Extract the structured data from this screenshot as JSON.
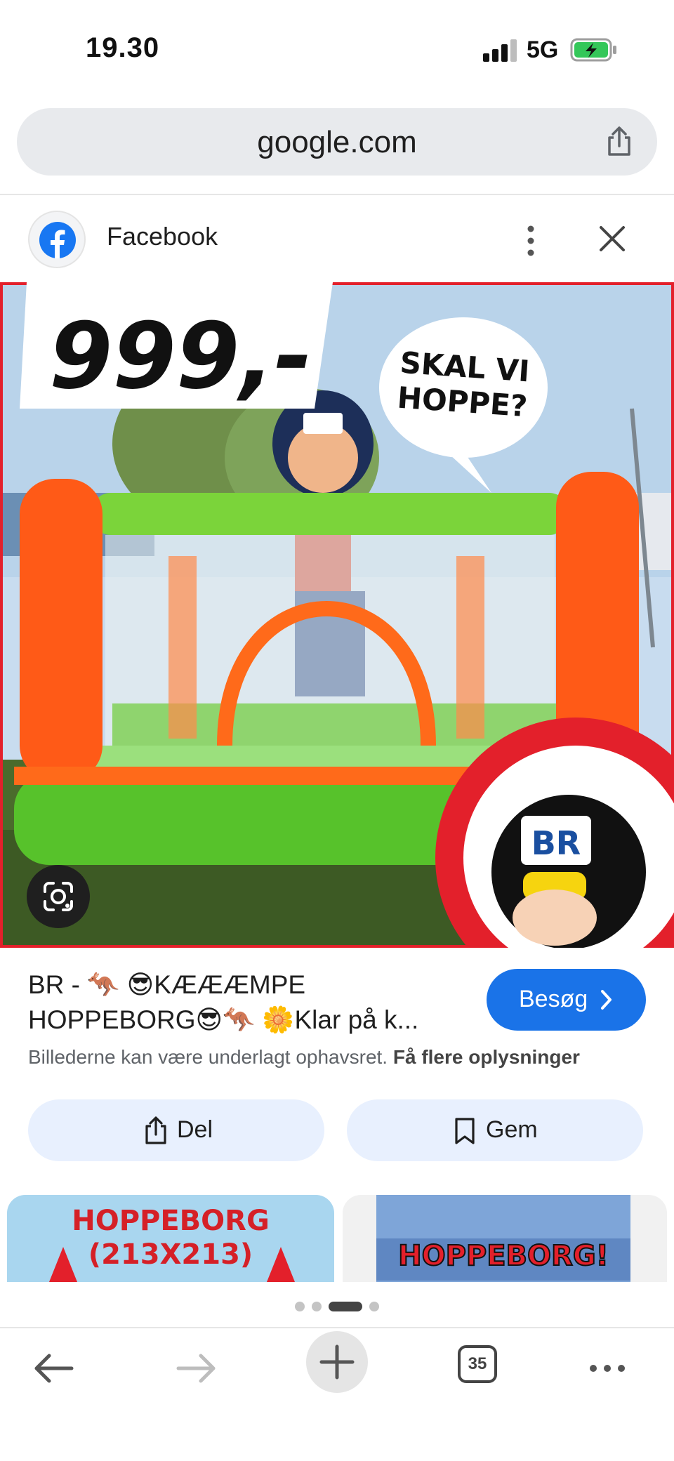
{
  "status_bar": {
    "time": "19.30",
    "network": "5G"
  },
  "url_bar": {
    "url": "google.com"
  },
  "source": {
    "name": "Facebook"
  },
  "image": {
    "price_tag": "999,-",
    "speech_bubble": "SKAL VI HOPPE?",
    "badge_text": "BR"
  },
  "result": {
    "title_line1": "BR - 🦘 😎KÆÆÆMPE",
    "title_line2": "HOPPEBORG😎🦘 🌼Klar på k...",
    "visit_label": "Besøg",
    "notice_text": "Billederne kan være underlagt ophavsret.",
    "notice_link": "Få flere oplysninger",
    "share_label": "Del",
    "save_label": "Gem"
  },
  "related": [
    {
      "line1": "HOPPEBORG",
      "line2": "(213X213)"
    },
    {
      "line1": "HOPPEBORG!"
    }
  ],
  "pager": {
    "count": 4,
    "active_index": 2
  },
  "bottom_nav": {
    "tab_count": "35"
  },
  "colors": {
    "accent": "#1a73e8",
    "facebook": "#1877f2",
    "battery": "#34c759"
  }
}
